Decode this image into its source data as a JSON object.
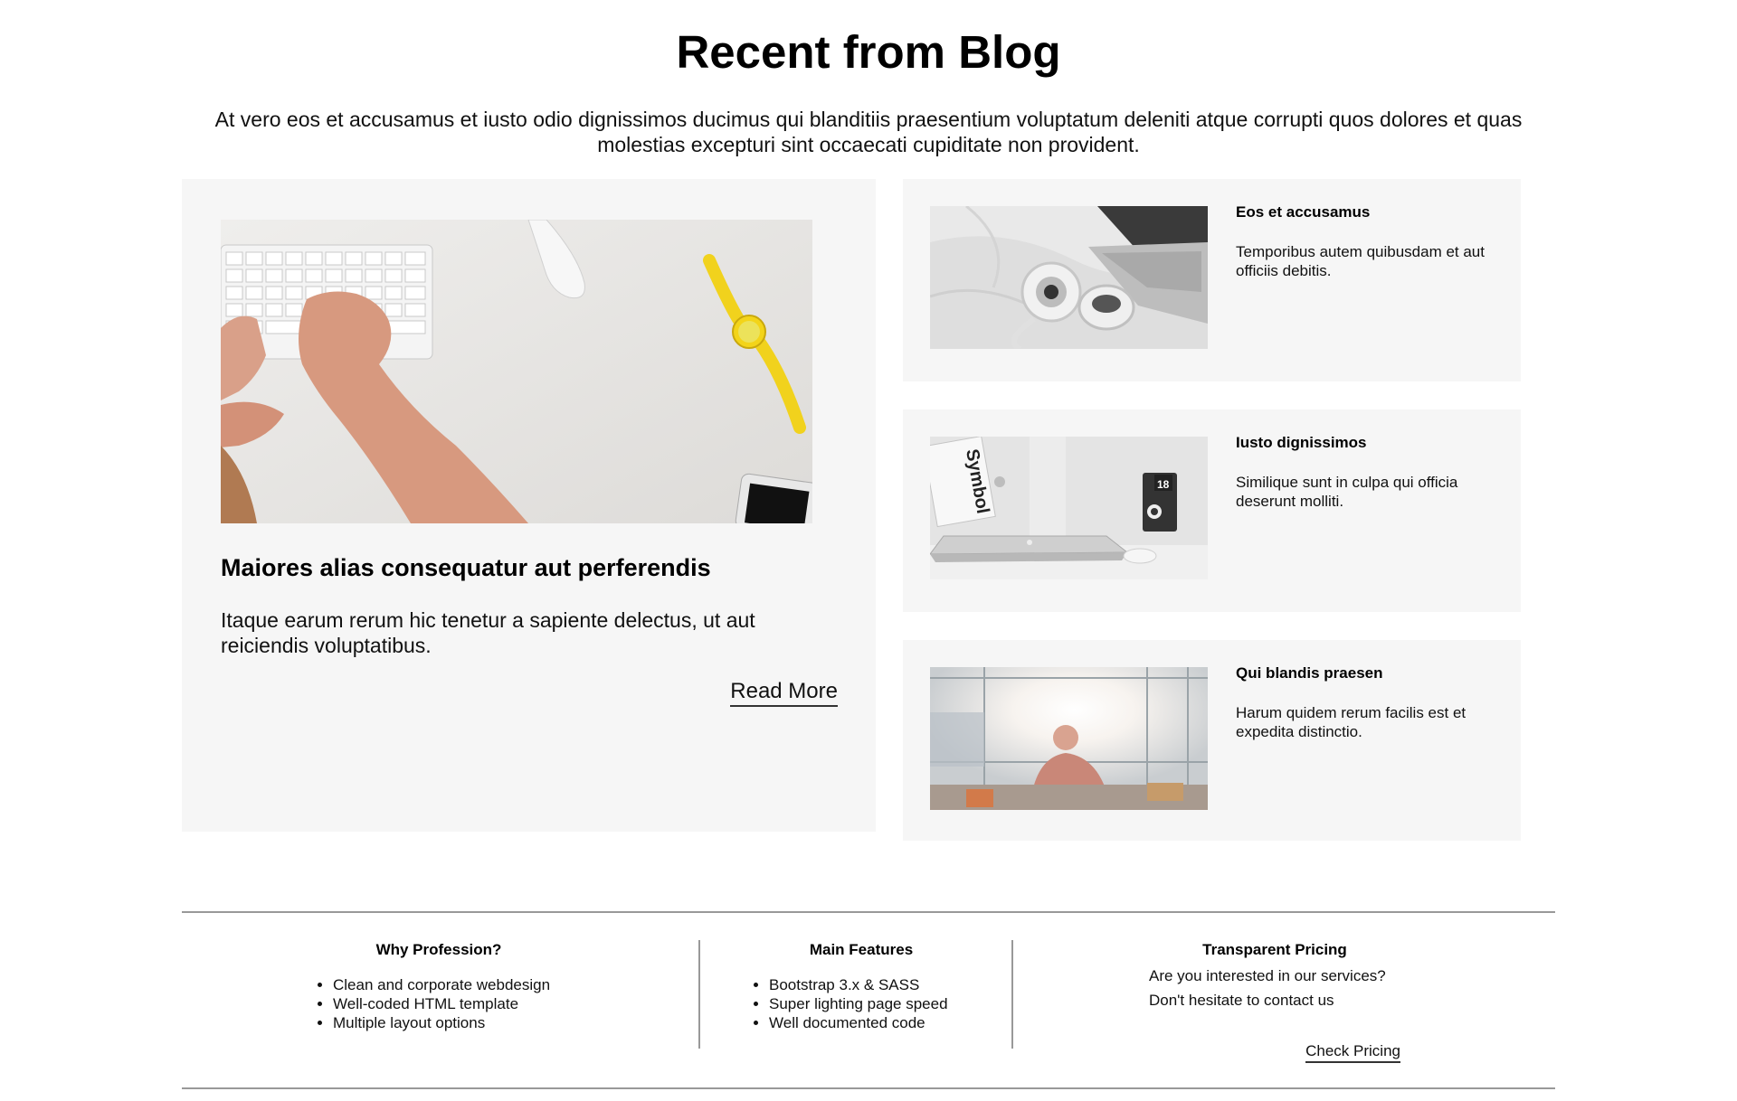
{
  "section": {
    "title": "Recent from Blog",
    "intro": "At vero eos et accusamus et iusto odio dignissimos ducimus qui blanditiis praesentium voluptatum deleniti atque corrupti quos dolores et quas molestias excepturi sint occaecati cupiditate non provident."
  },
  "featured": {
    "title": "Maiores alias consequatur aut perferendis",
    "text": "Itaque earum rerum hic tenetur a sapiente delectus, ut aut reiciendis voluptatibus.",
    "read_more": "Read More",
    "image": "keyboard-hands-watch-photo"
  },
  "posts": [
    {
      "title": "Eos et accusamus",
      "text": "Temporibus autem quibusdam et aut officiis debitis.",
      "image": "headphones-laptop-photo"
    },
    {
      "title": "Iusto dignissimos",
      "text": "Similique sunt in culpa qui officia deserunt molliti.",
      "image": "laptop-desk-photo"
    },
    {
      "title": "Qui blandis praesen",
      "text": "Harum quidem rerum facilis est et expedita distinctio.",
      "image": "man-window-photo"
    }
  ],
  "features": {
    "why": {
      "heading": "Why Profession?",
      "items": [
        "Clean and corporate webdesign",
        "Well-coded HTML template",
        "Multiple layout options"
      ]
    },
    "main": {
      "heading": "Main Features",
      "items": [
        "Bootstrap 3.x & SASS",
        "Super lighting page speed",
        "Well documented code"
      ]
    },
    "pricing": {
      "heading": "Transparent Pricing",
      "line1": "Are you interested in our services?",
      "line2": "Don't hesitate to contact us",
      "link": "Check Pricing"
    }
  },
  "photo_labels": {
    "book": "Symbol",
    "calendar": "18"
  }
}
